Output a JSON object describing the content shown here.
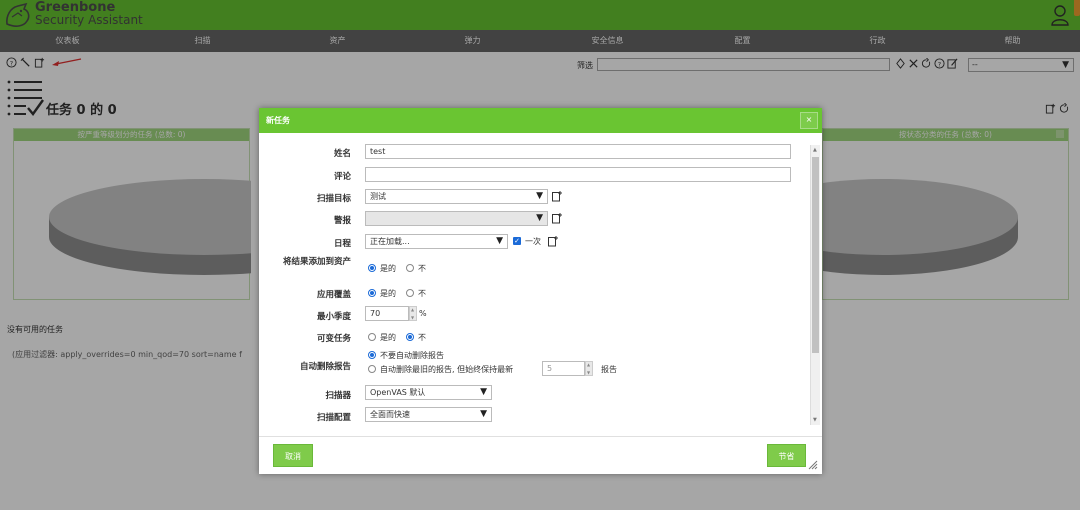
{
  "header": {
    "brand_line1": "Greenbone",
    "brand_line2": "Security Assistant",
    "logo_icon": "wolf-logo-icon",
    "user_icon": "user-icon"
  },
  "nav": {
    "items": [
      "仪表板",
      "扫描",
      "资产",
      "弹力",
      "安全信息",
      "配置",
      "行政",
      "帮助"
    ]
  },
  "toolbar": {
    "icons": [
      "help-icon",
      "wizard-icon",
      "new-task-icon"
    ],
    "filter_label": "筛选",
    "filter_value": "",
    "filter_icons": [
      "refresh-icon",
      "clear-icon",
      "reset-icon",
      "help-icon",
      "edit-icon"
    ],
    "filter_select_value": "--"
  },
  "page": {
    "title": "任务 0 的 0",
    "no_tasks": "没有可用的任务",
    "applied_filter": "(应用过滤器: apply_overrides=0 min_qod=70 sort=name f"
  },
  "charts": {
    "left_title": "按严重等级划分的任务 (总数: 0)",
    "right_title": "按状态分类的任务 (总数: 0)"
  },
  "dialog": {
    "title": "新任务",
    "close_label": "×",
    "fields": {
      "name_label": "姓名",
      "name_value": "test",
      "comment_label": "评论",
      "comment_value": "",
      "target_label": "扫描目标",
      "target_value": "测试",
      "alert_label": "警报",
      "alert_value": "",
      "schedule_label": "日程",
      "schedule_value": "正在加载...",
      "schedule_once": "一次",
      "add_assets_label": "将结果添加到资产",
      "add_assets_yes": "是的",
      "add_assets_no": "不",
      "apply_overrides_label": "应用覆盖",
      "apply_overrides_yes": "是的",
      "apply_overrides_no": "不",
      "min_qod_label": "最小季度",
      "min_qod_value": "70",
      "min_qod_unit": "%",
      "alterable_label": "可变任务",
      "alterable_yes": "是的",
      "alterable_no": "不",
      "auto_delete_label": "自动删除报告",
      "auto_delete_opt1": "不要自动删除报告",
      "auto_delete_opt2": "自动删除最旧的报告, 但始终保持最新",
      "auto_delete_keep": "5",
      "auto_delete_reports": "报告",
      "scanner_label": "扫描器",
      "scanner_value": "OpenVAS 默认",
      "scan_config_label": "扫描配置",
      "scan_config_value": "全面而快速"
    },
    "states": {
      "add_assets": "yes",
      "apply_overrides": "yes",
      "alterable": "no",
      "auto_delete": "opt1",
      "schedule_once_checked": true
    },
    "cancel_label": "取消",
    "save_label": "节省"
  },
  "colors": {
    "brand_green": "#66c430",
    "nav_gray": "#666666",
    "dialog_header": "#6ac532",
    "button_green": "#7fcb4a",
    "radio_blue": "#1b6ad7"
  }
}
